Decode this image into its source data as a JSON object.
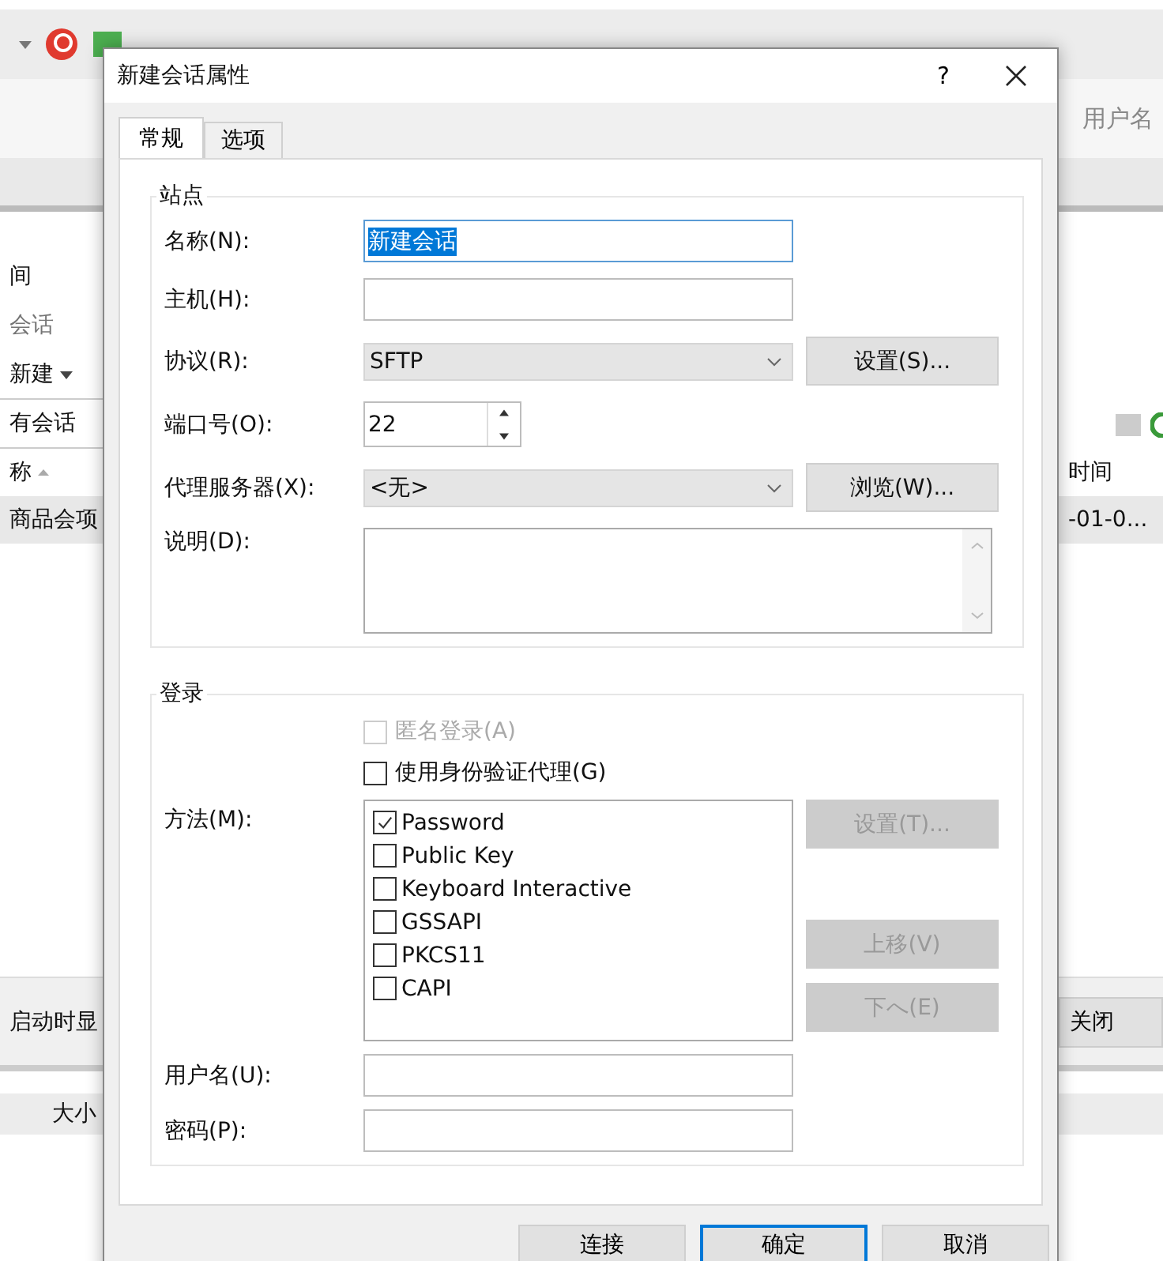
{
  "background": {
    "toolbar_label": "用户名",
    "left_panel": {
      "heading": "间",
      "search": {
        "placeholder": "会话"
      },
      "new_button": "新建",
      "filter_label": "有会话",
      "column_header": "称",
      "row": {
        "text": "商品会项",
        "selected": true
      },
      "footer_text": "启动时显",
      "bottom_header": "大小"
    },
    "right_panel": {
      "column_header": "时间",
      "row": {
        "text": "-01-0...",
        "selected": true
      },
      "close_button": "关闭"
    }
  },
  "dialog": {
    "title": "新建会话属性",
    "help": "?",
    "tabs": [
      {
        "label": "常规",
        "selected": true
      },
      {
        "label": "选项",
        "selected": false
      }
    ],
    "site": {
      "title": "站点",
      "name": {
        "label": "名称(N):",
        "value": "新建会话",
        "text_selected": true
      },
      "host": {
        "label": "主机(H):"
      },
      "protocol": {
        "label": "协议(R):",
        "value": "SFTP",
        "button": "设置(S)..."
      },
      "port": {
        "label": "端口号(O):",
        "value": "22"
      },
      "proxy": {
        "label": "代理服务器(X):",
        "value": "<无>",
        "button": "浏览(W)..."
      },
      "description": {
        "label": "说明(D):"
      }
    },
    "login": {
      "title": "登录",
      "options": [
        {
          "label": "匿名登录(A)",
          "checked": false,
          "disabled": true
        },
        {
          "label": "使用身份验证代理(G)",
          "checked": false,
          "disabled": false
        }
      ],
      "method_label": "方法(M):",
      "methods": [
        {
          "label": "Password",
          "checked": true
        },
        {
          "label": "Public Key",
          "checked": false
        },
        {
          "label": "Keyboard Interactive",
          "checked": false
        },
        {
          "label": "GSSAPI",
          "checked": false
        },
        {
          "label": "PKCS11",
          "checked": false
        },
        {
          "label": "CAPI",
          "checked": false
        }
      ],
      "method_buttons": [
        {
          "label": "设置(T)...",
          "disabled": true
        },
        {
          "label": "上移(V)",
          "disabled": true
        },
        {
          "label": "下へ(E)",
          "disabled": true
        }
      ],
      "username": {
        "label": "用户名(U):"
      },
      "password": {
        "label": "密码(P):"
      }
    },
    "buttons": [
      {
        "label": "连接",
        "default": false
      },
      {
        "label": "确定",
        "default": true
      },
      {
        "label": "取消",
        "default": false
      }
    ]
  }
}
